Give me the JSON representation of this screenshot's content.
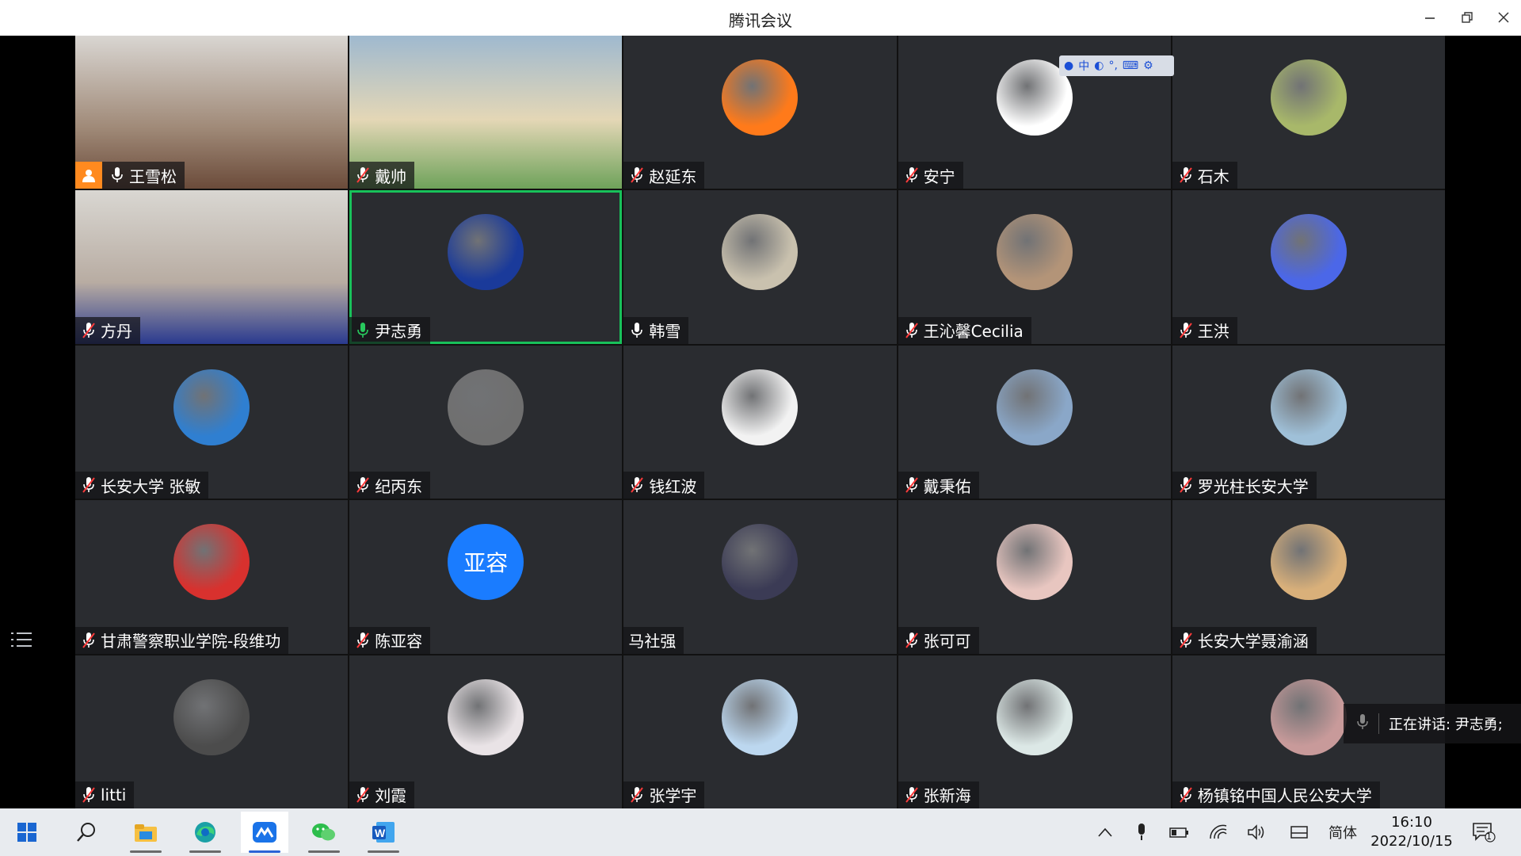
{
  "window": {
    "title": "腾讯会议",
    "minimize_icon": "minimize-icon",
    "restore_icon": "restore-icon",
    "close_icon": "close-icon"
  },
  "participants": [
    {
      "name": "王雪松",
      "mic": "on",
      "host": true,
      "video": true
    },
    {
      "name": "戴帅",
      "mic": "muted",
      "video": true
    },
    {
      "name": "赵延东",
      "mic": "muted",
      "avatar_color": "#ff7a1a"
    },
    {
      "name": "安宁",
      "mic": "muted",
      "avatar_color": "#ffffff"
    },
    {
      "name": "石木",
      "mic": "muted",
      "avatar_color": "#a8b86a"
    },
    {
      "name": "方丹",
      "mic": "muted",
      "video": true
    },
    {
      "name": "尹志勇",
      "mic": "speaking",
      "active": true,
      "avatar_color": "#1a3a9a"
    },
    {
      "name": "韩雪",
      "mic": "on",
      "avatar_color": "#c9c1ae"
    },
    {
      "name": "王沁馨Cecilia",
      "mic": "muted",
      "avatar_color": "#b39478"
    },
    {
      "name": "王洪",
      "mic": "muted",
      "avatar_color": "#4b67e8"
    },
    {
      "name": "长安大学 张敏",
      "mic": "muted",
      "avatar_color": "#2f7fd1"
    },
    {
      "name": "纪丙东",
      "mic": "muted",
      "avatar_color": "#6f6f6f"
    },
    {
      "name": "钱红波",
      "mic": "muted",
      "avatar_color": "#f2f2f2"
    },
    {
      "name": "戴秉佑",
      "mic": "muted",
      "avatar_color": "#8aa7c8"
    },
    {
      "name": "罗光柱长安大学",
      "mic": "muted",
      "avatar_color": "#9fc0d8"
    },
    {
      "name": "甘肃警察职业学院-段维功",
      "mic": "muted",
      "avatar_color": "#d8312e"
    },
    {
      "name": "陈亚容",
      "mic": "muted",
      "avatar_text": "亚容",
      "avatar_color": "#1a7cff"
    },
    {
      "name": "马社强",
      "mic": "none",
      "avatar_color": "#3b3b55"
    },
    {
      "name": "张可可",
      "mic": "muted",
      "avatar_color": "#e8c6c0"
    },
    {
      "name": "长安大学聂渝涵",
      "mic": "muted",
      "avatar_color": "#d9b07a"
    },
    {
      "name": "litti",
      "mic": "muted",
      "avatar_color": "#4c4c4c"
    },
    {
      "name": "刘霞",
      "mic": "muted",
      "avatar_color": "#e9e3e6"
    },
    {
      "name": "张学宇",
      "mic": "muted",
      "avatar_color": "#bcd7ef"
    },
    {
      "name": "张新海",
      "mic": "muted",
      "avatar_color": "#dce8e6"
    },
    {
      "name": "杨镇铭中国人民公安大学",
      "mic": "muted",
      "avatar_color": "#c89a9a"
    }
  ],
  "ime": {
    "lang": "中"
  },
  "speaking": {
    "text": "正在讲话: 尹志勇;"
  },
  "taskbar": {
    "apps": [
      "start-icon",
      "search-icon",
      "file-explorer-icon",
      "edge-icon",
      "tencent-meeting-icon",
      "wechat-icon",
      "word-icon"
    ],
    "ime_label": "简体",
    "time": "16:10",
    "date": "2022/10/15",
    "notification_count": "1"
  }
}
